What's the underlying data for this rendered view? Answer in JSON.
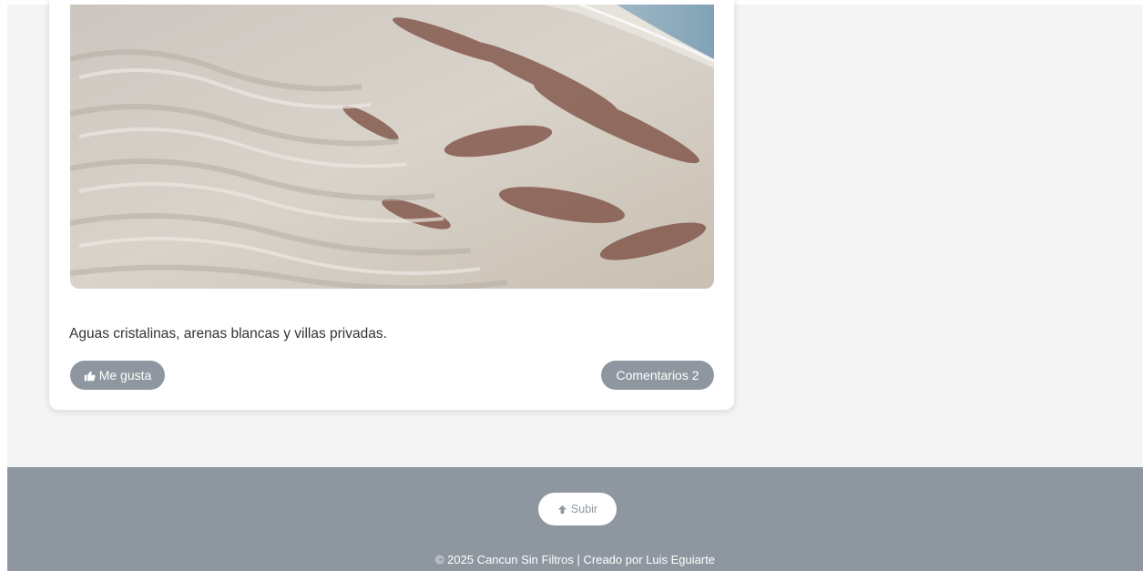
{
  "post": {
    "image_alt": "beach-sand-photo",
    "caption": "Aguas cristalinas, arenas blancas y villas privadas.",
    "like_label": "Me gusta",
    "comments_label": "Comentarios 2"
  },
  "footer": {
    "up_label": "Subir",
    "copyright": "© 2025 Cancun Sin Filtros | Creado por Luis Eguiarte"
  },
  "colors": {
    "page_bg": "#f4f4f4",
    "footer_bg": "#8e979f",
    "pill_bg": "#8e979f",
    "card_bg": "#ffffff"
  },
  "icons": {
    "like": "thumbs-up-icon",
    "up": "arrow-up-icon"
  }
}
